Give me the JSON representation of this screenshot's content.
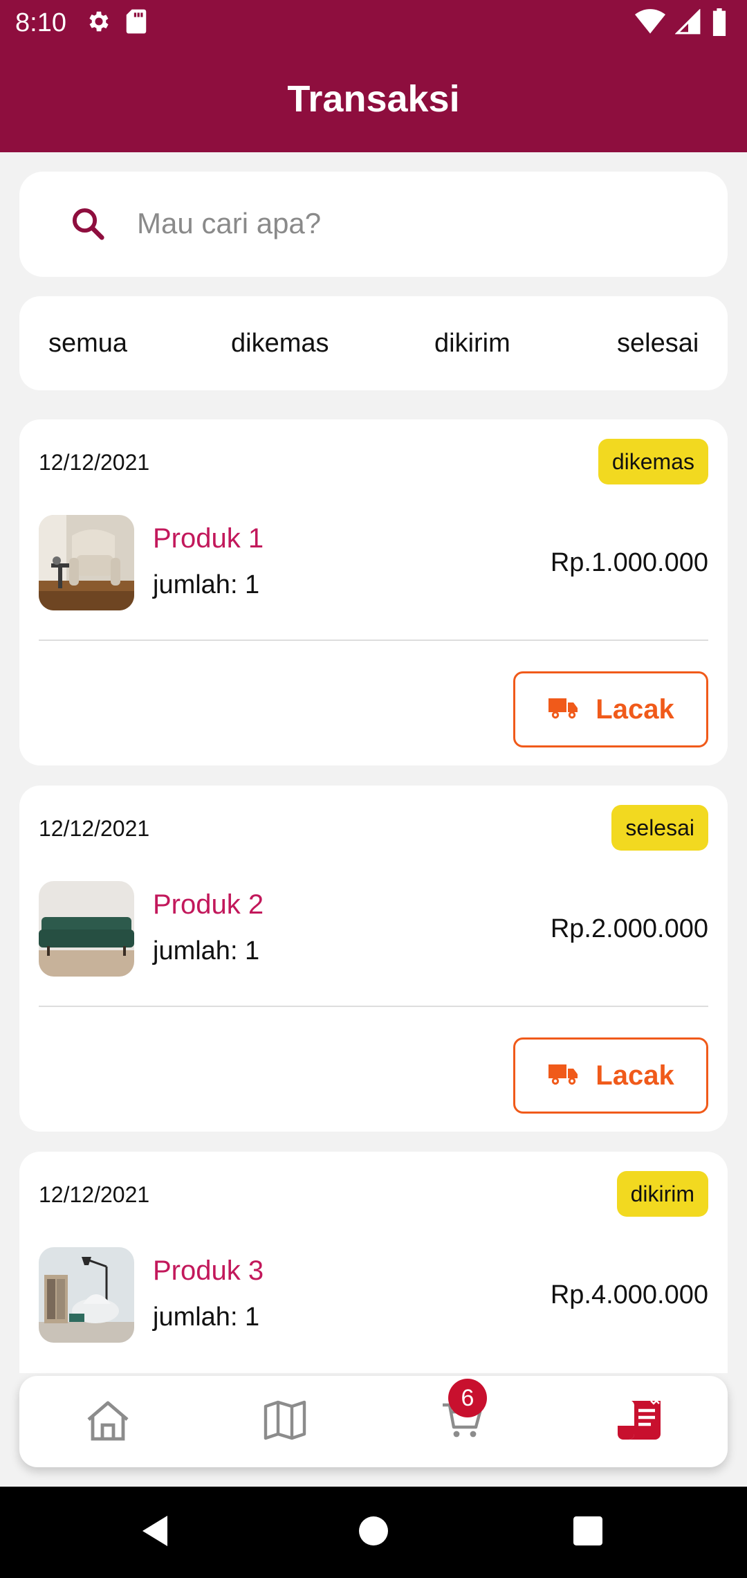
{
  "status_bar": {
    "time": "8:10",
    "left_icons": [
      "gear-icon",
      "sd-card-icon"
    ],
    "right_icons": [
      "wifi-icon",
      "signal-icon",
      "battery-icon"
    ]
  },
  "header": {
    "title": "Transaksi",
    "color": "#8E0E3E"
  },
  "search": {
    "placeholder": "Mau cari apa?",
    "value": ""
  },
  "tabs": [
    {
      "label": "semua"
    },
    {
      "label": "dikemas"
    },
    {
      "label": "dikirim"
    },
    {
      "label": "selesai"
    }
  ],
  "orders": [
    {
      "date": "12/12/2021",
      "status": "dikemas",
      "product": "Produk 1",
      "qty": "jumlah: 1",
      "price": "Rp.1.000.000",
      "track_label": "Lacak"
    },
    {
      "date": "12/12/2021",
      "status": "selesai",
      "product": "Produk 2",
      "qty": "jumlah: 1",
      "price": "Rp.2.000.000",
      "track_label": "Lacak"
    },
    {
      "date": "12/12/2021",
      "status": "dikirim",
      "product": "Produk 3",
      "qty": "jumlah: 1",
      "price": "Rp.4.000.000"
    }
  ],
  "bottom_nav": {
    "items": [
      "home-icon",
      "map-icon",
      "cart-icon",
      "receipt-icon"
    ],
    "active": "receipt-icon",
    "cart_count": "6",
    "active_color": "#C8102E"
  },
  "colors": {
    "badge": "#F2D920",
    "track": "#F05A1A",
    "product_name": "#C2185B"
  }
}
